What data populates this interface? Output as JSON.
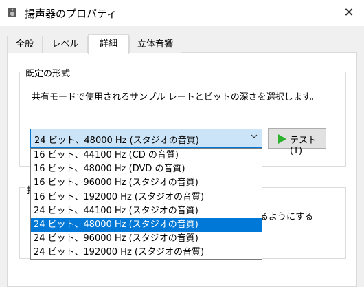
{
  "window": {
    "title": "揚声器のプロパティ",
    "close_glyph": "✕"
  },
  "tabs": [
    {
      "label": "全般"
    },
    {
      "label": "レベル"
    },
    {
      "label": "詳細"
    },
    {
      "label": "立体音響"
    }
  ],
  "default_format": {
    "group_label": "既定の形式",
    "description": "共有モードで使用されるサンプル レートとビットの深さを選択します。",
    "selected_value": "24 ビット、48000 Hz (スタジオの音質)",
    "test_button_label": "テスト(T)",
    "options": [
      "16 ビット、44100 Hz (CD の音質)",
      "16 ビット、48000 Hz (DVD の音質)",
      "16 ビット、96000 Hz (スタジオの音質)",
      "16 ビット、192000 Hz (スタジオの音質)",
      "24 ビット、44100 Hz (スタジオの音質)",
      "24 ビット、48000 Hz (スタジオの音質)",
      "24 ビット、96000 Hz (スタジオの音質)",
      "24 ビット、192000 Hz (スタジオの音質)"
    ],
    "selected_index": 5
  },
  "second_group": {
    "label_fragment": "排",
    "partial_text": "るようにする"
  },
  "colors": {
    "accent": "#0078d7",
    "combo_bg": "#cce4f7",
    "play_green": "#2db22d"
  }
}
